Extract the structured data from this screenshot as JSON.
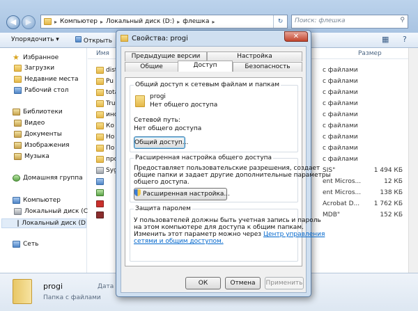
{
  "explorer": {
    "address": [
      "Компьютер",
      "Локальный диск (D:)",
      "флешка"
    ],
    "search_placeholder": "Поиск: флешка",
    "toolbar": {
      "organize": "Упорядочить ▾",
      "open": "Открыть"
    },
    "columns": {
      "name": "Имя",
      "size": "Размер"
    },
    "sidebar": {
      "favorites": "Избранное",
      "downloads": "Загрузки",
      "recent": "Недавние места",
      "desktop": "Рабочий стол",
      "libraries": "Библиотеки",
      "video": "Видео",
      "documents": "Документы",
      "images": "Изображения",
      "music": "Музыка",
      "homegroup": "Домашняя группа",
      "computer": "Компьютер",
      "disk_c": "Локальный диск (C",
      "disk_d": "Локальный диск (D",
      "network": "Сеть"
    },
    "files": [
      {
        "name": "dist",
        "type": "с файлами",
        "size": ""
      },
      {
        "name": "Pu",
        "type": "с файлами",
        "size": ""
      },
      {
        "name": "tota",
        "type": "с файлами",
        "size": ""
      },
      {
        "name": "Tru",
        "type": "с файлами",
        "size": ""
      },
      {
        "name": "инс",
        "type": "с файлами",
        "size": ""
      },
      {
        "name": "Ко",
        "type": "с файлами",
        "size": ""
      },
      {
        "name": "Но",
        "type": "с файлами",
        "size": ""
      },
      {
        "name": "По",
        "type": "с файлами",
        "size": ""
      },
      {
        "name": "про",
        "type": "с файлами",
        "size": ""
      },
      {
        "name": "Syg",
        "type": "SIS\"",
        "size": "1 494 КБ"
      },
      {
        "name": "",
        "type": "ent Micros...",
        "size": "12 КБ"
      },
      {
        "name": "",
        "type": "ent Micros...",
        "size": "138 КБ"
      },
      {
        "name": "",
        "type": "Acrobat D...",
        "size": "1 762 КБ"
      },
      {
        "name": "",
        "type": "MDB\"",
        "size": "152 КБ"
      }
    ],
    "details": {
      "name": "progi",
      "type": "Папка с файлами",
      "date_label": "Дата и"
    }
  },
  "dialog": {
    "title": "Свойства: progi",
    "close": "✕",
    "tabs_back": [
      "Предыдущие версии",
      "Настройка"
    ],
    "tabs_front": [
      "Общие",
      "Доступ",
      "Безопасность"
    ],
    "share_group": {
      "title": "Общий доступ к сетевым файлам и папкам",
      "folder_name": "progi",
      "folder_status": "Нет общего доступа",
      "net_path_label": "Сетевой путь:",
      "net_path_value": "Нет общего доступа",
      "share_button": "Общий доступ..."
    },
    "advanced_group": {
      "title": "Расширенная настройка общего доступа",
      "text": [
        "Предоставляет пользовательские разрешения, создает",
        "общие папки и задает другие дополнительные параметры",
        "общего доступа."
      ],
      "button": "Расширенная настройка..."
    },
    "password_group": {
      "title": "Защита паролем",
      "text": [
        "У пользователей должны быть учетная запись и пароль",
        "на этом компьютере для доступа к общим папкам.",
        "Изменить этот параметр можно через "
      ],
      "link_a": "Центр управления",
      "link_b": "сетями и общим доступом."
    },
    "buttons": {
      "ok": "ОК",
      "cancel": "Отмена",
      "apply": "Применить"
    }
  }
}
